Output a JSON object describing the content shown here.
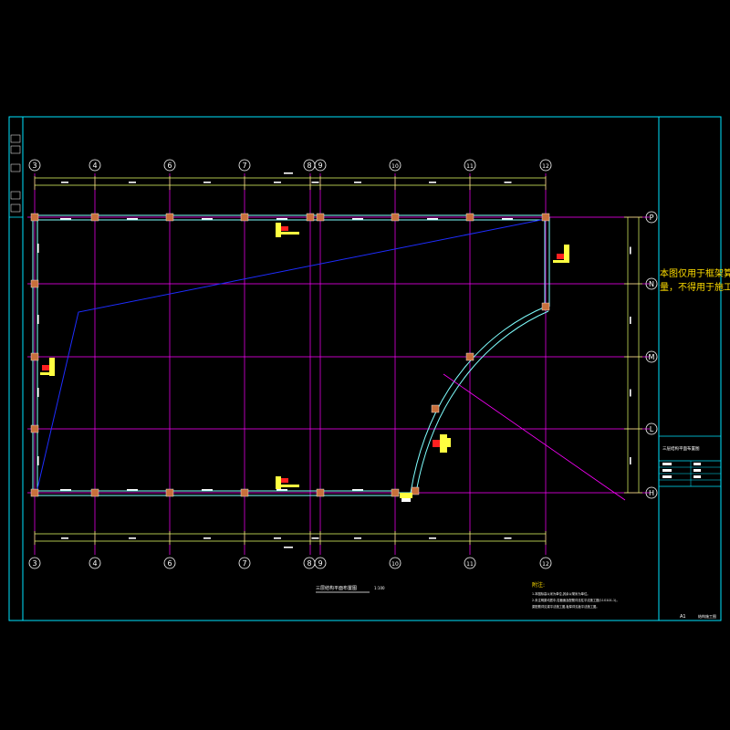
{
  "sheet": {
    "notice_line1": "本图仅用于框架算",
    "notice_line2": "量，不得用于施工",
    "sheet_number": "A1",
    "sheet_note": "结构施工图",
    "drawing_title": "三层结构平面布置图",
    "scale": "1:100",
    "tb_title": "三层结构平面布置图"
  },
  "axes": {
    "vertical": [
      "3",
      "4",
      "6",
      "7",
      "8",
      "9",
      "10",
      "11",
      "12"
    ],
    "horizontal": [
      "P",
      "N",
      "M",
      "L",
      "H"
    ]
  },
  "notes": {
    "heading": "附注:",
    "lines": [
      "1.本图标高以米为单位,其余以毫米为单位。",
      "2.未注明梁均居中,柱截面及配筋详见柱平法施工图(11G101-1)。",
      "   梁配筋详见梁平法施工图,板厚详见板平法施工图。"
    ]
  },
  "colors": {
    "background": "#000000",
    "frame": "#00e5ff",
    "grid": "#ff00ff",
    "dimension": "#e6ff66",
    "beam": "#7fffff",
    "column": "#c8703c",
    "section_line": "#1e2dff",
    "notice": "#ffdd00",
    "axis_bubble": "#ffffff",
    "label_white": "#ffffff",
    "label_red": "#ff2020",
    "label_yellow": "#ffff40"
  }
}
